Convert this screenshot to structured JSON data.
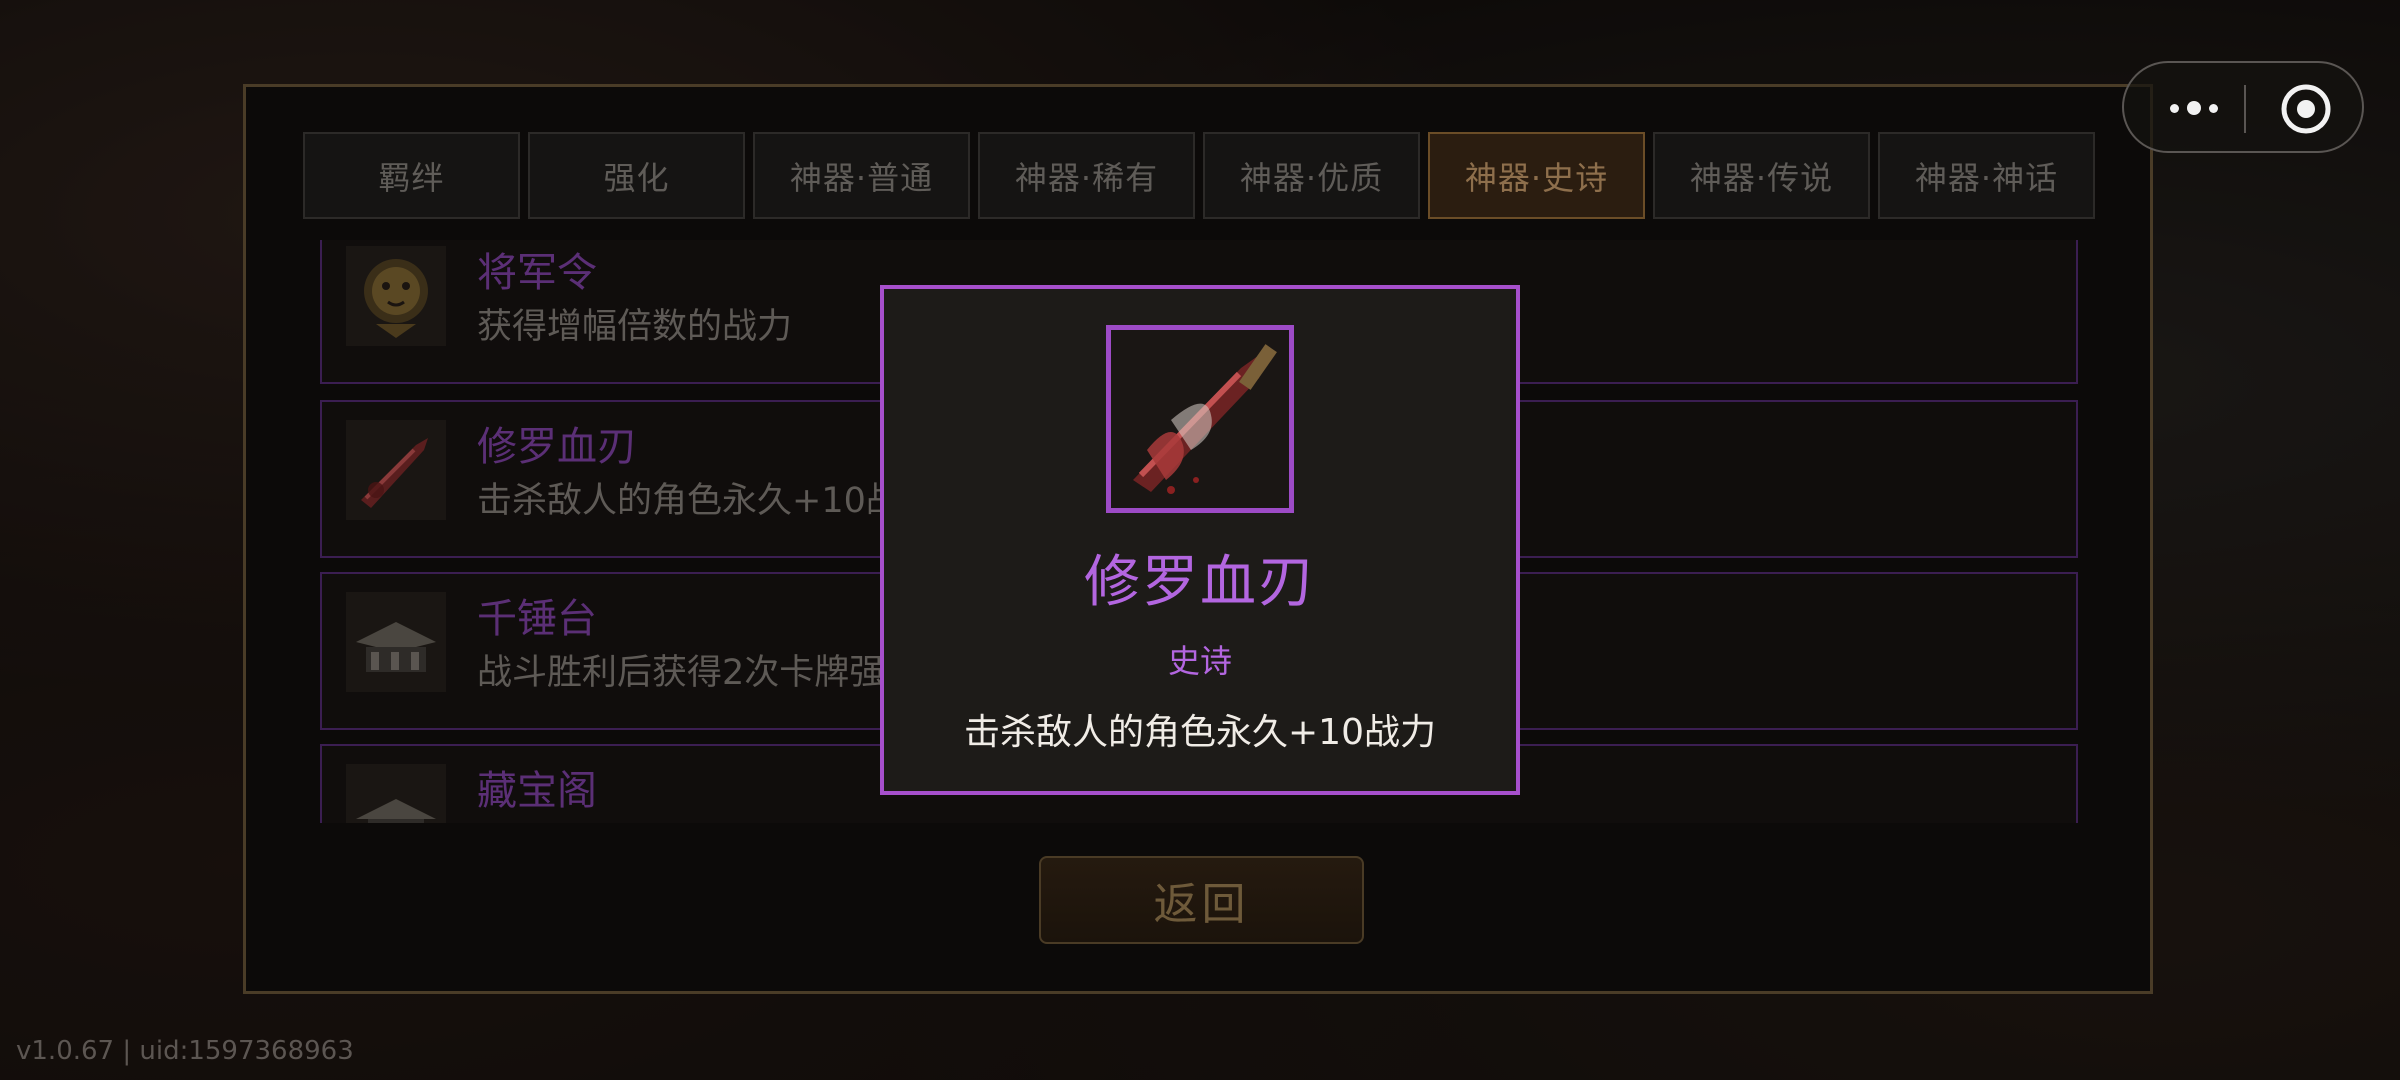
{
  "tabs": [
    {
      "label": "羁绊",
      "active": false
    },
    {
      "label": "强化",
      "active": false
    },
    {
      "label": "神器·普通",
      "active": false
    },
    {
      "label": "神器·稀有",
      "active": false
    },
    {
      "label": "神器·优质",
      "active": false
    },
    {
      "label": "神器·史诗",
      "active": true
    },
    {
      "label": "神器·传说",
      "active": false
    },
    {
      "label": "神器·神话",
      "active": false
    }
  ],
  "items": [
    {
      "name": "将军令",
      "desc": "获得增幅倍数的战力",
      "icon": "tiger-token-icon"
    },
    {
      "name": "修罗血刃",
      "desc": "击杀敌人的角色永久+10战力",
      "icon": "blood-blade-icon"
    },
    {
      "name": "千锤台",
      "desc": "战斗胜利后获得2次卡牌强化",
      "icon": "forge-platform-icon"
    },
    {
      "name": "藏宝阁",
      "desc": "",
      "icon": "treasure-pavilion-icon"
    }
  ],
  "back_label": "返回",
  "popup": {
    "title": "修罗血刃",
    "rarity": "史诗",
    "desc": "击杀敌人的角色永久+10战力",
    "icon": "blood-blade-icon",
    "accent": "#b366e0"
  },
  "version": "v1.0.67 | uid:1597368963",
  "colors": {
    "epic": "#a64fcc",
    "active_tab": "#2b1d10",
    "gold_border": "#4a3c27"
  }
}
